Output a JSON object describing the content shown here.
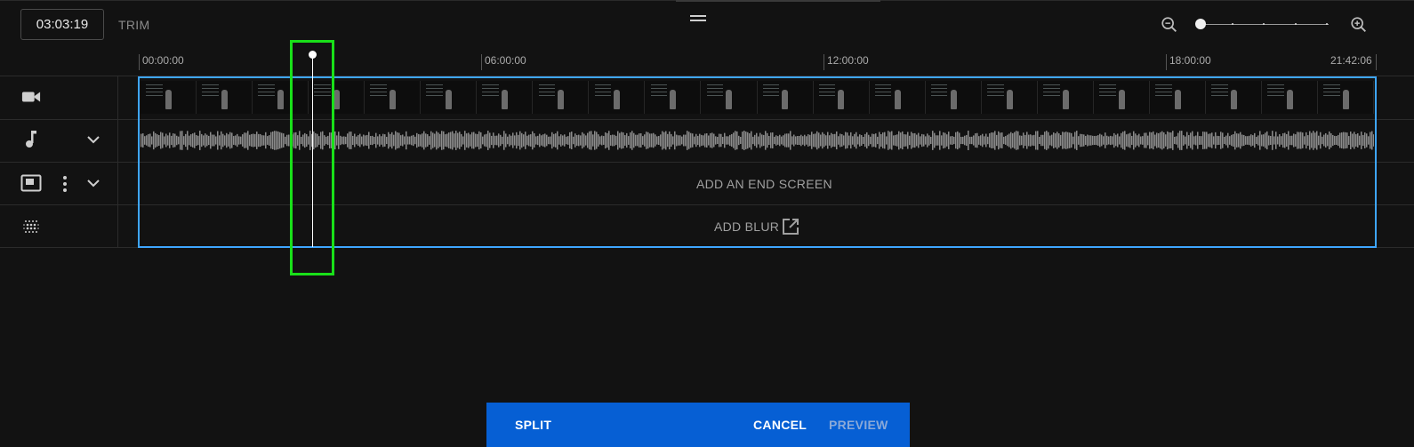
{
  "header": {
    "current_time": "03:03:19",
    "mode_label": "TRIM"
  },
  "zoom": {
    "out_icon": "zoom-out-icon",
    "in_icon": "zoom-in-icon",
    "level": 0
  },
  "ruler": {
    "labels": [
      "00:00:00",
      "06:00:00",
      "12:00:00",
      "18:00:00",
      "21:42:06"
    ]
  },
  "tracks": {
    "video": {
      "icon": "video-camera-icon"
    },
    "audio": {
      "icon": "music-note-icon",
      "expand_icon": "chevron-down-icon"
    },
    "end_screen": {
      "icon": "end-screen-icon",
      "menu_icon": "more-vert-icon",
      "expand_icon": "chevron-down-icon",
      "label": "ADD AN END SCREEN"
    },
    "blur": {
      "icon": "blur-icon",
      "label": "ADD BLUR",
      "link_icon": "open-in-new-icon"
    }
  },
  "playhead": {
    "time": "03:03:19"
  },
  "actions": {
    "split": "SPLIT",
    "cancel": "CANCEL",
    "preview": "PREVIEW"
  },
  "colors": {
    "accent": "#3ea6ff",
    "action_bar": "#065fd4",
    "highlight": "#19e019"
  }
}
